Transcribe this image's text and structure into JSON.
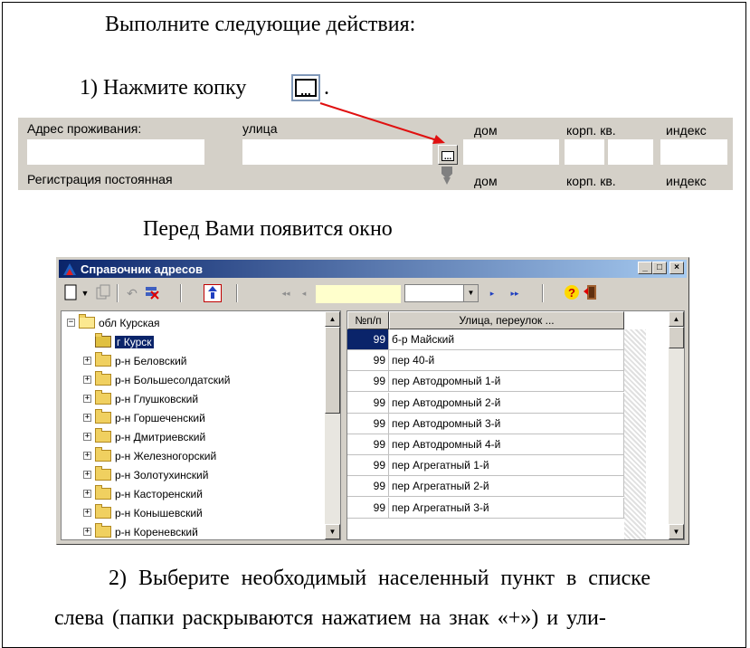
{
  "intro": "Выполните следующие действия:",
  "step1": "1) Нажмите копку",
  "step1_period": ".",
  "form": {
    "label_address": "Адрес проживания:",
    "label_street": "улица",
    "label_house": "дом",
    "label_korp_kv": "корп. кв.",
    "label_index": "индекс",
    "label_registration": "Регистрация постоянная",
    "label_house2": "дом",
    "label_korp_kv2": "корп. кв.",
    "label_index2": "индекс"
  },
  "appear_text": "Перед Вами появится окно",
  "window": {
    "title": "Справочник адресов",
    "min_glyph": "_",
    "max_glyph": "□",
    "close_glyph": "×",
    "tree": [
      {
        "label": "обл Курская",
        "expander": "−",
        "level": 0,
        "icon": "open-folder-icon"
      },
      {
        "label": "г Курск",
        "expander": "",
        "level": 1,
        "icon": "city-icon",
        "selected": true
      },
      {
        "label": "р-н Беловский",
        "expander": "+",
        "level": 1,
        "icon": "folder-icon"
      },
      {
        "label": "р-н Большесолдатский",
        "expander": "+",
        "level": 1,
        "icon": "folder-icon"
      },
      {
        "label": "р-н Глушковский",
        "expander": "+",
        "level": 1,
        "icon": "folder-icon"
      },
      {
        "label": "р-н Горшеченский",
        "expander": "+",
        "level": 1,
        "icon": "folder-icon"
      },
      {
        "label": "р-н Дмитриевский",
        "expander": "+",
        "level": 1,
        "icon": "folder-icon"
      },
      {
        "label": "р-н Железногорский",
        "expander": "+",
        "level": 1,
        "icon": "folder-icon"
      },
      {
        "label": "р-н Золотухинский",
        "expander": "+",
        "level": 1,
        "icon": "folder-icon"
      },
      {
        "label": "р-н Касторенский",
        "expander": "+",
        "level": 1,
        "icon": "folder-icon"
      },
      {
        "label": "р-н Конышевский",
        "expander": "+",
        "level": 1,
        "icon": "folder-icon"
      },
      {
        "label": "р-н Кореневский",
        "expander": "+",
        "level": 1,
        "icon": "folder-icon"
      }
    ],
    "grid_headers": {
      "num": "№п/п",
      "name": "Улица, переулок ..."
    },
    "grid_rows": [
      {
        "num": "99",
        "name": "б-р Майский"
      },
      {
        "num": "99",
        "name": "пер 40-й"
      },
      {
        "num": "99",
        "name": "пер Автодромный 1-й"
      },
      {
        "num": "99",
        "name": "пер Автодромный 2-й"
      },
      {
        "num": "99",
        "name": "пер Автодромный 3-й"
      },
      {
        "num": "99",
        "name": "пер Автодромный 4-й"
      },
      {
        "num": "99",
        "name": "пер Агрегатный 1-й"
      },
      {
        "num": "99",
        "name": "пер Агрегатный 2-й"
      },
      {
        "num": "99",
        "name": "пер Агрегатный 3-й"
      }
    ]
  },
  "step2_line1": "2) Выберите необходимый населенный пункт в списке",
  "step2_line2": "слева (папки раскрываются нажатием на знак «+») и ули-",
  "colors": {
    "arrow": "#e01010",
    "titlebar": "#0a246a",
    "selection": "#0a246a",
    "window_bg": "#d4d0c8"
  }
}
